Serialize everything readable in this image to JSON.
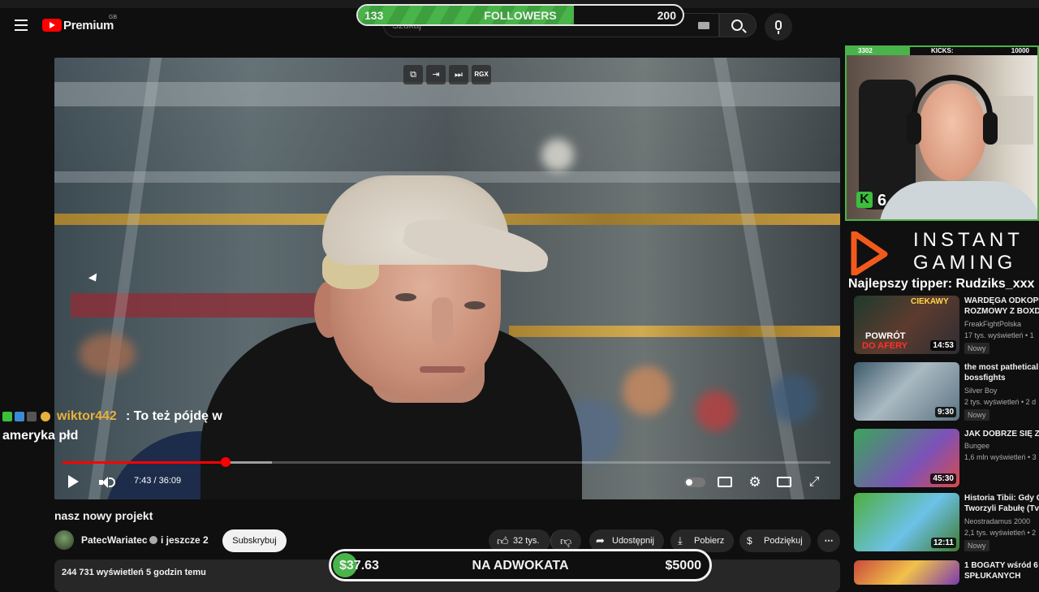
{
  "header": {
    "logo_text": "Premium",
    "logo_region": "GB",
    "search_placeholder": "Szukaj"
  },
  "followers_goal": {
    "current": "133",
    "label": "FOLLOWERS",
    "target": "200",
    "progress": 0.665
  },
  "player": {
    "top_buttons": [
      "RGX"
    ],
    "time": "7:43 / 36:09",
    "progress": 0.213
  },
  "chat": {
    "user": "wiktor442",
    "message_line1": ": To też pójdę w",
    "message_line2": "ameryka płd"
  },
  "video": {
    "title": "nasz nowy projekt",
    "channel": "PatecWariatec",
    "and_more": "i jeszcze 2",
    "subscribe": "Subskrybuj",
    "likes": "32 tys.",
    "share": "Udostępnij",
    "download": "Pobierz",
    "thanks": "Podziękuj",
    "views_time": "244 731 wyświetleń  5 godzin temu"
  },
  "donation_goal": {
    "current": "$37.63",
    "label": "NA ADWOKATA",
    "target": "$5000"
  },
  "webcam": {
    "left_value": "3302",
    "kicks_label": "KICKS:",
    "right_value": "10000",
    "badge_letter": "K",
    "badge_count": "6"
  },
  "sponsor": {
    "line1": "INSTANT",
    "line2": "GAMING"
  },
  "tipper": "Najlepszy tipper: Rudziks_xxx",
  "recommended": [
    {
      "title1": "WARDĘGA ODKOPU",
      "title2": "ROZMOWY Z BOXD",
      "channel": "FreakFightPolska",
      "views": "17 tys. wyświetleń • 1",
      "badge": "Nowy",
      "duration": "14:53"
    },
    {
      "title1": "the most pathetical",
      "title2": "bossfights",
      "channel": "Silver Boy",
      "views": "2 tys. wyświetleń • 2 d",
      "badge": "Nowy",
      "duration": "9:30"
    },
    {
      "title1": "JAK DOBRZE SIĘ ZI",
      "title2": "",
      "channel": "Bungee",
      "views": "1,6 mln wyświetleń • 3",
      "badge": "",
      "duration": "45:30"
    },
    {
      "title1": "Historia Tibii: Gdy G",
      "title2": "Tworzyli Fabułę (Tv",
      "channel": "Neostradamus 2000",
      "views": "2,1 tys. wyświetleń • 2",
      "badge": "Nowy",
      "duration": "12:11"
    },
    {
      "title1": "1 BOGATY wśród 6",
      "title2": "SPŁUKANYCH",
      "channel": "",
      "views": "",
      "badge": "",
      "duration": ""
    }
  ],
  "thumb_texts": {
    "t1a": "CIEKAWY",
    "t1b": "POWRÓT",
    "t1c": "DO AFERY"
  },
  "colors": {
    "accent_red": "#ff0000",
    "goal_green": "#49b449",
    "chat_user": "#e8b13b"
  }
}
